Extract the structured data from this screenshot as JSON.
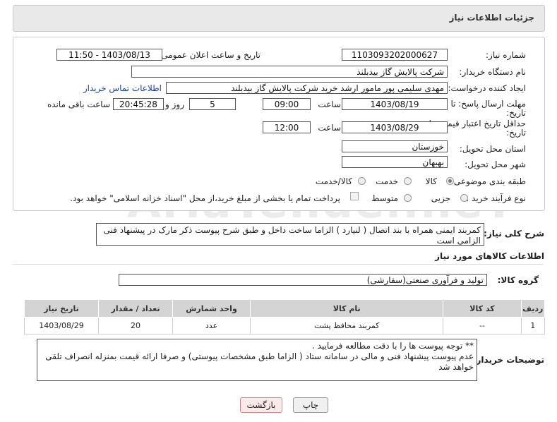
{
  "header": {
    "title": "جزئیات اطلاعات نیاز"
  },
  "form": {
    "need_number_label": "شماره نیاز:",
    "need_number": "1103093202000627",
    "announce_label": "تاریخ و ساعت اعلان عمومی:",
    "announce_value": "1403/08/13 - 11:50",
    "buyer_org_label": "نام دستگاه خریدار:",
    "buyer_org": "شرکت پالایش گاز بیدبلند",
    "creator_label": "ایجاد کننده درخواست:",
    "creator": "مهدی سلیمی پور مامور ارشد خرید شرکت پالایش گاز بیدبلند",
    "contact_link": "اطلاعات تماس خریدار",
    "deadline_label": "مهلت ارسال پاسخ: تا",
    "deadline_label2": "تاریخ:",
    "deadline_date": "1403/08/19",
    "time_label": "ساعت",
    "deadline_time": "09:00",
    "days_value": "5",
    "days_label": "روز و",
    "remaining_time": "20:45:28",
    "remaining_label": "ساعت باقی مانده",
    "validity_label": "حداقل تاریخ اعتبار قیمت: تا",
    "validity_label2": "تاریخ:",
    "validity_date": "1403/08/29",
    "validity_time": "12:00",
    "province_label": "استان محل تحویل:",
    "province": "خوزستان",
    "city_label": "شهر محل تحویل:",
    "city": "بهبهان",
    "category_label": "طبقه بندی موضوعی:",
    "category_options": [
      "کالا",
      "خدمت",
      "کالا/خدمت"
    ],
    "category_selected": "کالا",
    "process_label": "نوع فرآیند خرید :",
    "process_options": [
      "جزیی",
      "متوسط"
    ],
    "process_note": "پرداخت تمام یا بخشی از مبلغ خرید،از محل \"اسناد خزانه اسلامی\" خواهد بود."
  },
  "description": {
    "label": "شرح کلی نیاز:",
    "text": "کمربند ایمنی همراه با بند اتصال ( لنیارد )  الزاما ساخت داخل و طبق شرح پیوست  ذکر مارک در پیشنهاد فنی الزامی است"
  },
  "goods_section": {
    "title": "اطلاعات کالاهای مورد نیاز",
    "group_label": "گروه کالا:",
    "group_value": "تولید و فرآوری صنعتی(سفارشی)"
  },
  "table": {
    "headers": [
      "ردیف",
      "کد کالا",
      "نام کالا",
      "واحد شمارش",
      "تعداد / مقدار",
      "تاریخ نیاز"
    ],
    "rows": [
      [
        "1",
        "--",
        "کمربند محافظ پشت",
        "عدد",
        "20",
        "1403/08/29"
      ]
    ]
  },
  "buyer_notes": {
    "label": "توضیحات خریدار:",
    "line1": "** توجه پیوست ها  را با دقت مطالعه فرمایید .",
    "line2": "عدم پیوست پیشنهاد فنی و مالی در سامانه ستاد ( الزاما طبق مشخصات پیوستی)  و صرفا ارائه قیمت بمنزله انصراف تلقی خواهد شد"
  },
  "buttons": {
    "print": "چاپ",
    "back": "بازگشت"
  },
  "watermark": "AriaTender.neT"
}
